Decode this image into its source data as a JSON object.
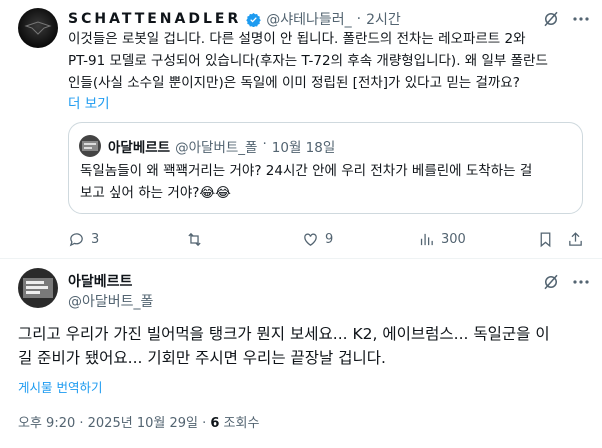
{
  "top_post": {
    "author_name": "SCHATTENADLER",
    "handle": "@샤테나들러_",
    "time": "2시간",
    "separator": "·",
    "text_lines": [
      "이것들은 로봇일 겁니다. 다른 설명이 안 됩니다. 폴란드의 전차는 레오파르트 2와",
      "PT-91 모델로 구성되어 있습니다(후자는 T-72의 후속 개량형입니다). 왜 일부 폴란드",
      "인들(사실 소수일 뿐이지만)은 독일에 이미 정립된 [전차]가 있다고 믿는 걸까요?"
    ],
    "show_more": "더 보기",
    "quote": {
      "author_name": "아달베르트",
      "handle": "@아달버트_폴",
      "time": "10월 18일",
      "separator": "·",
      "text_lines": [
        "독일놈들이 왜 꽥꽥거리는 거야? 24시간 안에 우리 전차가 베를린에 도착하는 걸",
        "보고 싶어 하는 거야?😂😂"
      ]
    },
    "actions": {
      "replies": "3",
      "reposts": "",
      "likes": "9",
      "views": "300"
    }
  },
  "main_post": {
    "author_name": "아달베르트",
    "handle": "@아달버트_폴",
    "text_lines": [
      "그리고 우리가 가진 빌어먹을 탱크가 뭔지 보세요... K2, 에이브럼스... 독일군을 이",
      "길 준비가 됐어요... 기회만 주시면 우리는 끝장날 겁니다."
    ],
    "translate": "게시물 번역하기",
    "meta_time": "오후 9:20 · 2025년 10월 29일 · ",
    "meta_views_count": "6",
    "meta_views_label": " 조회수"
  },
  "colors": {
    "text": "#0f1419",
    "muted": "#536471",
    "link": "#1d9bf0",
    "verified": "#1d9bf0"
  },
  "icons": [
    "grok-slash-icon",
    "more-icon",
    "reply-icon",
    "repost-icon",
    "like-icon",
    "views-icon",
    "bookmark-icon",
    "share-icon",
    "verified-icon"
  ]
}
